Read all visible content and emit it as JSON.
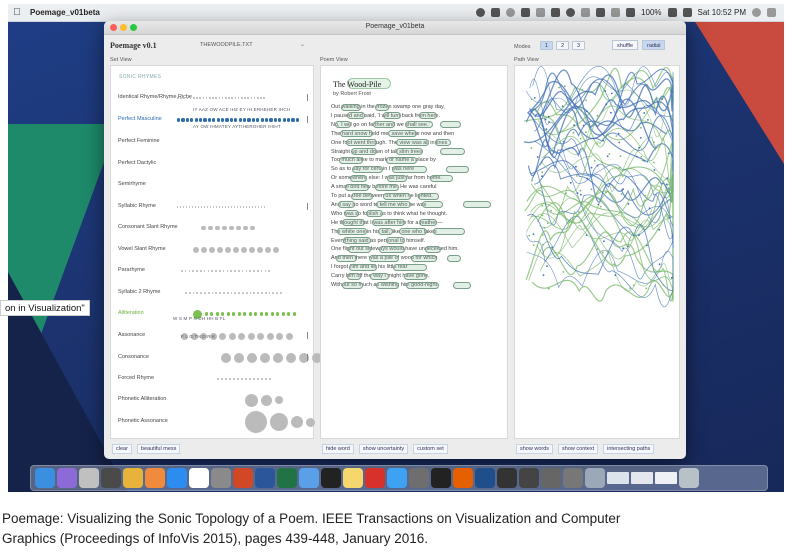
{
  "menubar": {
    "app_name": "Poemage_v01beta",
    "battery": "100%",
    "clock": "Sat 10:52 PM"
  },
  "window": {
    "title": "Poemage_v01beta",
    "app_name": "Poemage v0.1",
    "file_name": "THEWOODPILE.TXT",
    "modes_label": "Modes",
    "modes": [
      "1",
      "2",
      "3"
    ],
    "shuffle_label": "shuffle",
    "radial_label": "radial"
  },
  "panels": {
    "set_view_label": "Set View",
    "poem_view_label": "Poem View",
    "path_view_label": "Path View"
  },
  "set_view": {
    "section_label": "SONIC RHYMES",
    "rows": [
      {
        "label": "Identical Rhyme/Rhyme Riche"
      },
      {
        "label": "Perfect Masculine"
      },
      {
        "label": "Perfect Feminine"
      },
      {
        "label": "Perfect Dactylic"
      },
      {
        "label": "Semirhyme"
      },
      {
        "label": "Syllabic Rhyme"
      },
      {
        "label": "Consonant Slant Rhyme"
      },
      {
        "label": "Vowel Slant Rhyme"
      },
      {
        "label": "Pararhyme"
      },
      {
        "label": "Syllabic 2 Rhyme"
      },
      {
        "label": "Alliteration"
      },
      {
        "label": "Assonance"
      },
      {
        "label": "Consonance"
      },
      {
        "label": "Forced Rhyme"
      },
      {
        "label": "Phonetic Alliteration"
      },
      {
        "label": "Phonetic Assonance"
      }
    ],
    "masculine_codes_top": "IY  AAZ  OW ACE IHZ EY IH ERHEHER IHCH",
    "masculine_codes_bottom": "AY  OW IHMATEY AYTIHEROHER IHIHT",
    "alliteration_codes_top": "W   S  M  P  N  DH HH  B  FL",
    "alliteration_codes_bottom": "F   L   G  TH  D  R  K",
    "clear_label": "clear",
    "beautiful_label": "beautiful mess"
  },
  "poem_view": {
    "title": "The Wood-Pile",
    "author": "by Robert Frost",
    "lines": [
      "Out walking in the frozen swamp one gray day,",
      "I paused and said, 'I will turn back from here.",
      "No, I will go on farther and we shall see.'",
      "The hard snow held me, save where now and then",
      "One foot went through. The view was all in lines",
      "Straight up and down of tall slim trees",
      "Too much alike to mark or name a place by",
      "So as to say for certain I was here",
      "Or somewhere else: I was just far from home.",
      "A small bird flew before me. He was careful",
      "To put a tree between us when he lighted,",
      "And say no word to tell me who he was",
      "Who was so foolish as to think what he thought.",
      "He thought that I was after him for a feather—",
      "The white one in his tail; like one who takes",
      "Everything said as personal to himself.",
      "One flight out sideways would have undeceived him.",
      "And then there was a pile of wood for which",
      "I forgot him and let his little fear",
      "Carry him off the way I might have gone,",
      "Without so much as wishing him good-night."
    ],
    "hide_word_label": "hide word",
    "show_uncertainty_label": "show uncertainty",
    "custom_set_label": "custom set"
  },
  "path_view": {
    "show_words_label": "show words",
    "show_context_label": "show context",
    "intersecting_paths_label": "intersecting paths"
  },
  "overlay": {
    "tooltip": "on in Visualization\""
  },
  "caption": {
    "line1": "Poemage: Visualizing the Sonic Topology of a Poem. IEEE Transactions on Visualization and Computer",
    "line2": "Graphics (Proceedings of InfoVis 2015), pages 439-448, January 2016."
  },
  "colors": {
    "highlight_blue": "#2c6cb0",
    "alliteration_green": "#7cc04f",
    "path_blue": "#3f6fb5",
    "path_green": "#7ab96b"
  },
  "dock": {
    "icons": [
      "finder-icon",
      "siri-icon",
      "launchpad-icon",
      "screenshot-icon",
      "chrome-icon",
      "photos-icon",
      "appstore-icon",
      "calendar-icon",
      "settings-icon",
      "powerpoint-icon",
      "word-icon",
      "excel-icon",
      "preview-icon",
      "terminal-icon",
      "notes-icon",
      "acrobat-icon",
      "safari-icon",
      "textwrangler-icon",
      "github-icon",
      "firefox-icon",
      "sourcetree-icon",
      "camera-icon",
      "piano-icon",
      "pen-icon",
      "pen-icon-2",
      "folder-icon",
      "window-icon",
      "window-icon-2",
      "window-icon-3",
      "trash-icon"
    ]
  }
}
